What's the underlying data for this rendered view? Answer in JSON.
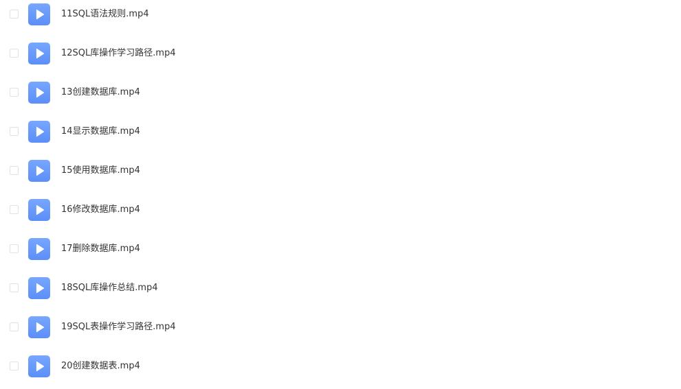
{
  "colors": {
    "icon_gradient_top": "#78a7ff",
    "icon_gradient_bottom": "#5b8ef8",
    "text": "#333333",
    "checkbox_border": "#e2e2e2"
  },
  "file_icon": "play-video-icon",
  "files": [
    {
      "name": "11SQL语法规则.mp4"
    },
    {
      "name": "12SQL库操作学习路径.mp4"
    },
    {
      "name": "13创建数据库.mp4"
    },
    {
      "name": "14显示数据库.mp4"
    },
    {
      "name": "15使用数据库.mp4"
    },
    {
      "name": "16修改数据库.mp4"
    },
    {
      "name": "17删除数据库.mp4"
    },
    {
      "name": "18SQL库操作总结.mp4"
    },
    {
      "name": "19SQL表操作学习路径.mp4"
    },
    {
      "name": "20创建数据表.mp4"
    }
  ]
}
